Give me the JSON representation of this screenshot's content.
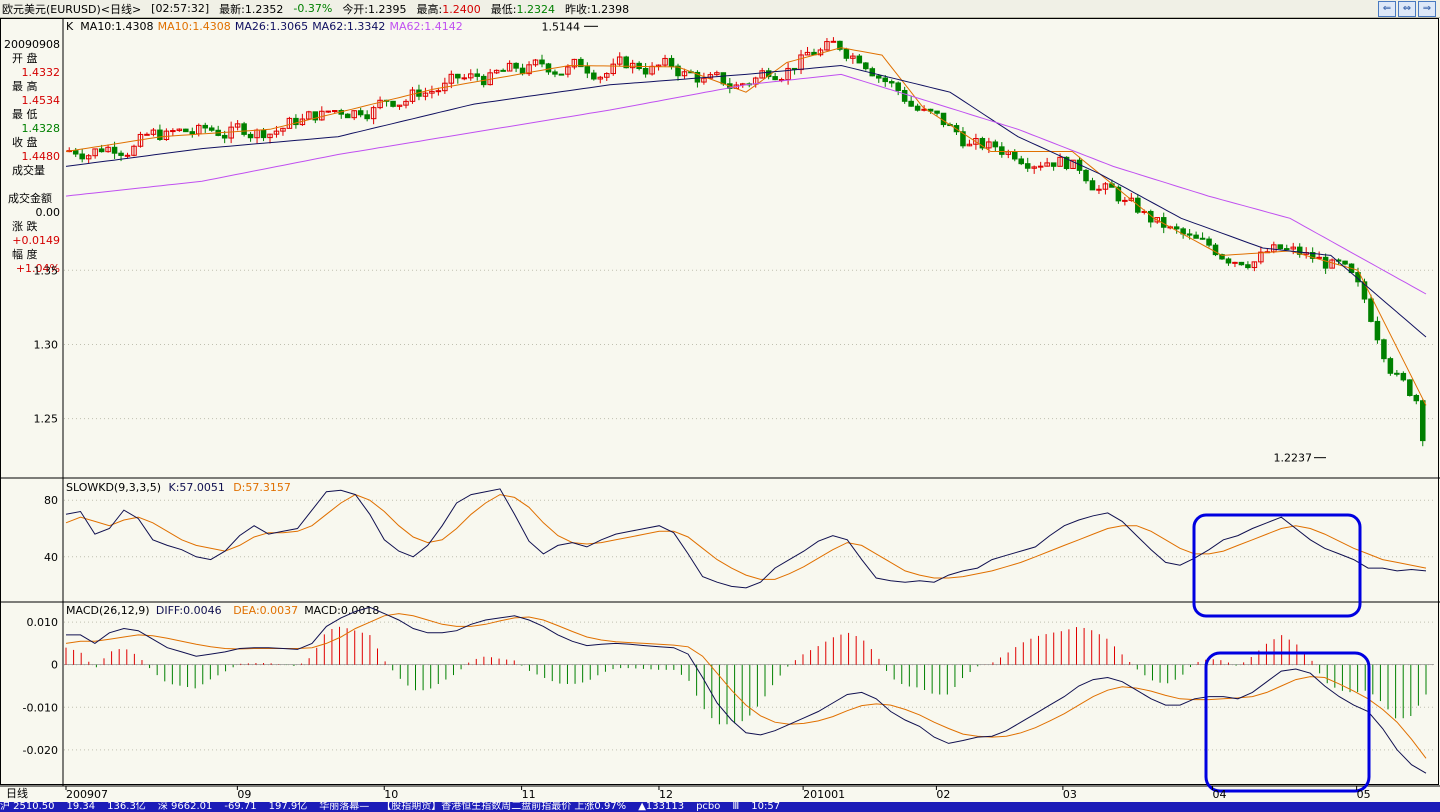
{
  "title_bar": {
    "instrument": "欧元美元(EURUSD)<日线>",
    "time": "[02:57:32]",
    "latest_label": "最新:",
    "latest": "1.2352",
    "change": "-0.37%",
    "open_label": "今开:",
    "open": "1.2395",
    "high_label": "最高:",
    "high": "1.2400",
    "low_label": "最低:",
    "low": "1.2324",
    "prev_label": "昨收:",
    "prev": "1.2398",
    "buttons": [
      "⇐",
      "⇔",
      "⇒"
    ]
  },
  "info_panel": {
    "date": "20090908",
    "open_label": "开  盘",
    "open": "1.4332",
    "high_label": "最  高",
    "high": "1.4534",
    "low_label": "最  低",
    "low": "1.4328",
    "close_label": "收  盘",
    "close": "1.4480",
    "volume_label": "成交量",
    "volume": "",
    "amount_label": "成交金额",
    "amount": "0.00",
    "chg_label": "涨  跌",
    "chg": "+0.0149",
    "pct_label": "幅  度",
    "pct": "+1.04%"
  },
  "colors": {
    "up": "#E00000",
    "down": "#008000",
    "ma10": "#E07000",
    "ma26": "#101060",
    "ma62": "#C050F0",
    "k": "#101050",
    "d": "#E07000",
    "highlight": "#0000E0",
    "grid": "#C0C0B0"
  },
  "chart_data": [
    {
      "type": "candlestick",
      "title": "",
      "legend": [
        {
          "text": "K",
          "color": "#000000"
        },
        {
          "text": "MA10:1.4308",
          "color": "#000000"
        },
        {
          "text": "MA10:1.4308",
          "color": "#E07000"
        },
        {
          "text": "MA26:1.3065",
          "color": "#101060"
        },
        {
          "text": "MA62:1.3342",
          "color": "#101060"
        },
        {
          "text": "MA62:1.4142",
          "color": "#C050F0"
        }
      ],
      "y_ticks": [
        "1.35",
        "1.30",
        "1.25"
      ],
      "ylim": [
        1.21,
        1.52
      ],
      "annotations": [
        {
          "text": "1.5144",
          "value": 1.5144
        },
        {
          "text": "1.2237",
          "value": 1.2237
        }
      ],
      "start_close": 1.43,
      "end_close": 1.2352,
      "ma_waypoints": {
        "ma10": [
          [
            0,
            1.43
          ],
          [
            0.07,
            1.44
          ],
          [
            0.15,
            1.445
          ],
          [
            0.27,
            1.472
          ],
          [
            0.37,
            1.488
          ],
          [
            0.45,
            1.487
          ],
          [
            0.5,
            1.47
          ],
          [
            0.53,
            1.49
          ],
          [
            0.57,
            1.5
          ],
          [
            0.6,
            1.495
          ],
          [
            0.63,
            1.46
          ],
          [
            0.68,
            1.43
          ],
          [
            0.74,
            1.43
          ],
          [
            0.8,
            1.385
          ],
          [
            0.85,
            1.36
          ],
          [
            0.9,
            1.363
          ],
          [
            0.95,
            1.35
          ],
          [
            1.0,
            1.259
          ]
        ],
        "ma26": [
          [
            0,
            1.42
          ],
          [
            0.1,
            1.432
          ],
          [
            0.2,
            1.44
          ],
          [
            0.3,
            1.462
          ],
          [
            0.4,
            1.475
          ],
          [
            0.5,
            1.482
          ],
          [
            0.57,
            1.488
          ],
          [
            0.65,
            1.47
          ],
          [
            0.7,
            1.44
          ],
          [
            0.76,
            1.415
          ],
          [
            0.82,
            1.385
          ],
          [
            0.88,
            1.365
          ],
          [
            0.93,
            1.36
          ],
          [
            1.0,
            1.305
          ]
        ],
        "ma62": [
          [
            0,
            1.4
          ],
          [
            0.1,
            1.41
          ],
          [
            0.2,
            1.428
          ],
          [
            0.3,
            1.443
          ],
          [
            0.4,
            1.458
          ],
          [
            0.5,
            1.475
          ],
          [
            0.57,
            1.482
          ],
          [
            0.63,
            1.465
          ],
          [
            0.7,
            1.445
          ],
          [
            0.77,
            1.42
          ],
          [
            0.84,
            1.4
          ],
          [
            0.9,
            1.385
          ],
          [
            1.0,
            1.334
          ]
        ]
      }
    },
    {
      "type": "line",
      "title": "SLOWKD(9,3,3,5)",
      "legend": [
        {
          "text": "SLOWKD(9,3,3,5)",
          "color": "#000000"
        },
        {
          "text": "K:57.0051",
          "color": "#101050"
        },
        {
          "text": "D:57.3157",
          "color": "#E07000"
        }
      ],
      "y_ticks": [
        "80",
        "40"
      ],
      "ylim": [
        8,
        95
      ],
      "series": [
        {
          "name": "K",
          "values": [
            70,
            72,
            56,
            60,
            73,
            67,
            52,
            48,
            45,
            40,
            38,
            44,
            55,
            62,
            56,
            58,
            60,
            73,
            86,
            87,
            84,
            70,
            52,
            44,
            40,
            48,
            62,
            78,
            84,
            86,
            88,
            70,
            51,
            42,
            48,
            50,
            47,
            52,
            56,
            58,
            60,
            62,
            57,
            42,
            26,
            22,
            19,
            18,
            22,
            32,
            38,
            44,
            51,
            55,
            52,
            38,
            25,
            23,
            22,
            23,
            22,
            27,
            30,
            32,
            38,
            41,
            44,
            47,
            55,
            62,
            66,
            69,
            71,
            65,
            55,
            45,
            36,
            34,
            39,
            45,
            52,
            55,
            60,
            64,
            68,
            60,
            52,
            46,
            42,
            38,
            32,
            32,
            30,
            31,
            30
          ]
        },
        {
          "name": "D",
          "values": [
            64,
            68,
            65,
            62,
            66,
            68,
            64,
            58,
            52,
            48,
            46,
            44,
            48,
            54,
            57,
            57,
            58,
            62,
            70,
            78,
            84,
            80,
            72,
            62,
            54,
            50,
            52,
            60,
            70,
            78,
            84,
            82,
            75,
            64,
            55,
            50,
            49,
            50,
            52,
            54,
            56,
            58,
            58,
            54,
            46,
            38,
            32,
            27,
            24,
            24,
            28,
            33,
            39,
            45,
            50,
            48,
            42,
            36,
            30,
            27,
            25,
            25,
            26,
            28,
            30,
            33,
            36,
            40,
            44,
            48,
            52,
            56,
            60,
            62,
            62,
            58,
            52,
            46,
            42,
            42,
            44,
            48,
            52,
            56,
            60,
            62,
            60,
            56,
            51,
            46,
            42,
            38,
            36,
            34,
            32
          ]
        }
      ]
    },
    {
      "type": "bar",
      "title": "MACD(26,12,9)",
      "legend": [
        {
          "text": "MACD(26,12,9)",
          "color": "#000000"
        },
        {
          "text": "DIFF:0.0046",
          "color": "#101050"
        },
        {
          "text": "DEA:0.0037",
          "color": "#E07000"
        },
        {
          "text": "MACD:0.0018",
          "color": "#000000"
        }
      ],
      "y_ticks": [
        "0.010",
        "0",
        "-0.010",
        "-0.020"
      ],
      "ylim": [
        -0.0285,
        0.0145
      ],
      "series": [
        {
          "name": "DIFF",
          "values": [
            0.007,
            0.007,
            0.005,
            0.0075,
            0.0085,
            0.008,
            0.006,
            0.004,
            0.003,
            0.002,
            0.0025,
            0.003,
            0.0038,
            0.004,
            0.004,
            0.0038,
            0.0036,
            0.005,
            0.009,
            0.011,
            0.0125,
            0.0135,
            0.012,
            0.0105,
            0.0085,
            0.0075,
            0.0075,
            0.008,
            0.0095,
            0.0105,
            0.011,
            0.0115,
            0.0105,
            0.009,
            0.007,
            0.0055,
            0.0045,
            0.0048,
            0.005,
            0.0048,
            0.0045,
            0.0042,
            0.004,
            0.0025,
            -0.003,
            -0.009,
            -0.013,
            -0.016,
            -0.0165,
            -0.0155,
            -0.014,
            -0.0125,
            -0.011,
            -0.009,
            -0.007,
            -0.0065,
            -0.008,
            -0.011,
            -0.013,
            -0.0145,
            -0.017,
            -0.0185,
            -0.0178,
            -0.017,
            -0.0168,
            -0.0155,
            -0.0135,
            -0.0115,
            -0.0095,
            -0.0075,
            -0.005,
            -0.0035,
            -0.003,
            -0.004,
            -0.006,
            -0.008,
            -0.0095,
            -0.0095,
            -0.008,
            -0.0075,
            -0.0075,
            -0.008,
            -0.0065,
            -0.004,
            -0.0015,
            -0.001,
            -0.002,
            -0.005,
            -0.0075,
            -0.0095,
            -0.011,
            -0.015,
            -0.02,
            -0.0235,
            -0.0255
          ]
        },
        {
          "name": "DEA",
          "values": [
            0.005,
            0.0055,
            0.0055,
            0.006,
            0.0065,
            0.007,
            0.0068,
            0.0062,
            0.0055,
            0.0048,
            0.0042,
            0.0038,
            0.0037,
            0.0038,
            0.0038,
            0.0038,
            0.0038,
            0.004,
            0.005,
            0.0065,
            0.0085,
            0.01,
            0.0115,
            0.012,
            0.0115,
            0.0105,
            0.0095,
            0.009,
            0.009,
            0.0095,
            0.0103,
            0.011,
            0.0112,
            0.0105,
            0.0092,
            0.0078,
            0.0065,
            0.0058,
            0.0054,
            0.0052,
            0.005,
            0.0048,
            0.0046,
            0.0042,
            0.002,
            -0.002,
            -0.006,
            -0.0095,
            -0.012,
            -0.0135,
            -0.014,
            -0.0138,
            -0.0132,
            -0.0122,
            -0.0108,
            -0.0096,
            -0.0092,
            -0.0095,
            -0.0105,
            -0.0118,
            -0.0135,
            -0.015,
            -0.0163,
            -0.0168,
            -0.017,
            -0.0168,
            -0.016,
            -0.0148,
            -0.0132,
            -0.0115,
            -0.0095,
            -0.0075,
            -0.006,
            -0.0052,
            -0.0055,
            -0.0062,
            -0.0072,
            -0.008,
            -0.0082,
            -0.0082,
            -0.008,
            -0.0078,
            -0.0075,
            -0.0065,
            -0.005,
            -0.0035,
            -0.0028,
            -0.003,
            -0.0045,
            -0.0062,
            -0.008,
            -0.0105,
            -0.0135,
            -0.0175,
            -0.022
          ]
        }
      ]
    }
  ],
  "x_axis": {
    "label": "日线",
    "ticks": [
      {
        "text": "200907",
        "pos": 0.0
      },
      {
        "text": "09",
        "pos": 0.126
      },
      {
        "text": "10",
        "pos": 0.234
      },
      {
        "text": "11",
        "pos": 0.335
      },
      {
        "text": "12",
        "pos": 0.436
      },
      {
        "text": "201001",
        "pos": 0.542
      },
      {
        "text": "02",
        "pos": 0.64
      },
      {
        "text": "03",
        "pos": 0.733
      },
      {
        "text": "04",
        "pos": 0.843
      },
      {
        "text": "05",
        "pos": 0.949
      }
    ]
  },
  "status_bar": {
    "items": [
      "沪 2510.50",
      "19.34",
      "136.3亿",
      "深 9662.01",
      "-69.71",
      "197.9亿",
      "华丽落幕—",
      "【股指期货】香港恒生指数周二盘前指最价 上涨0.97%",
      "▲133113",
      "pcbo",
      "Ⅲ",
      "10:57"
    ]
  }
}
